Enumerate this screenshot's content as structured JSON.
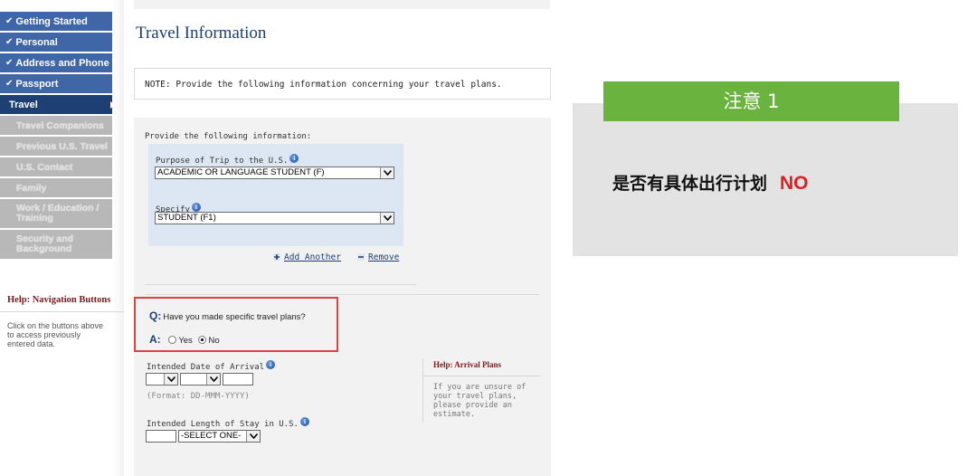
{
  "sidebar": {
    "items": [
      {
        "label": "Getting Started",
        "state": "done"
      },
      {
        "label": "Personal",
        "state": "done"
      },
      {
        "label": "Address and Phone",
        "state": "done"
      },
      {
        "label": "Passport",
        "state": "done"
      },
      {
        "label": "Travel",
        "state": "active"
      },
      {
        "label": "Travel Companions",
        "state": "disabled"
      },
      {
        "label": "Previous U.S. Travel",
        "state": "disabled"
      },
      {
        "label": "U.S. Contact",
        "state": "disabled"
      },
      {
        "label": "Family",
        "state": "disabled"
      },
      {
        "label": "Work / Education / Training",
        "state": "disabled"
      },
      {
        "label": "Security and Background",
        "state": "disabled"
      }
    ],
    "help": {
      "title_prefix": "Help:",
      "title": "Navigation Buttons",
      "text": "Click on the buttons above to access previously entered data."
    }
  },
  "main": {
    "title": "Travel Information",
    "note": "NOTE: Provide the following information concerning your travel plans.",
    "provide_label": "Provide the following information:",
    "purpose_label": "Purpose of Trip to the U.S.",
    "purpose_value": "ACADEMIC OR LANGUAGE STUDENT (F)",
    "specify_label": "Specify",
    "specify_value": "STUDENT (F1)",
    "add_another": "Add Another",
    "remove": "Remove",
    "question_prefix": "Q:",
    "question": "Have you made specific travel plans?",
    "answer_prefix": "A:",
    "yes_label": "Yes",
    "no_label": "No",
    "selected_answer": "No",
    "arrival_label": "Intended Date of Arrival",
    "date_format": "(Format: DD-MMM-YYYY)",
    "stay_label": "Intended Length of Stay in U.S.",
    "stay_unit_value": "-SELECT ONE-",
    "help_prefix": "Help:",
    "help_title": "Arrival Plans",
    "help_text": "If you are unsure of your travel plans, please provide an estimate."
  },
  "annotation": {
    "tab": "注意 1",
    "text": "是否有具体出行计划",
    "answer": "NO",
    "colors": {
      "tab": "#6bb33f",
      "answer": "#e02020",
      "card": "#e3e3e3"
    }
  }
}
